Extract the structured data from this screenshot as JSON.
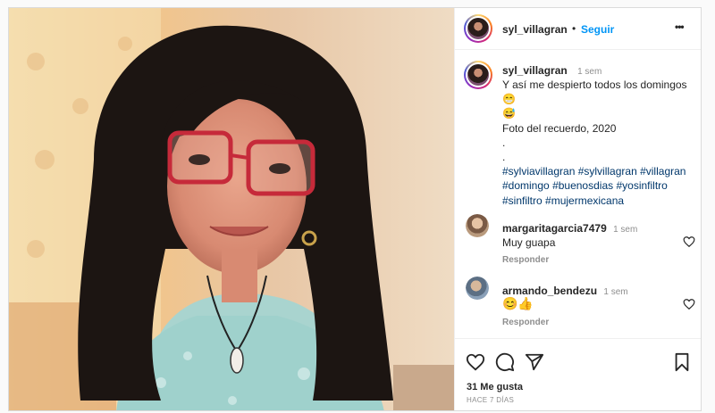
{
  "post": {
    "author": "syl_villagran",
    "separator": "•",
    "follow_label": "Seguir",
    "more_label": "•••",
    "caption": {
      "author": "syl_villagran",
      "age": "1 sem",
      "line1": "Y así me despierto todos los domingos😁",
      "line2": "😅",
      "line3": "Foto del recuerdo, 2020",
      "dot1": ".",
      "dot2": ".",
      "hashtags": [
        "#sylviavillagran",
        "#sylvillagran",
        "#villagran",
        "#domingo",
        "#buenosdias",
        "#yosinfiltro",
        "#sinfiltro",
        "#mujermexicana"
      ]
    },
    "comments": [
      {
        "user": "margaritagarcia7479",
        "age": "1 sem",
        "text": "Muy guapa",
        "reply_label": "Responder",
        "avatar_color": "#b99a7d"
      },
      {
        "user": "armando_bendezu",
        "age": "1 sem",
        "text": "😊👍",
        "reply_label": "Responder",
        "avatar_color": "#8aa0b8"
      }
    ],
    "likes": "31 Me gusta",
    "timestamp": "HACE 7 DÍAS",
    "icons": [
      "heart-icon",
      "comment-icon",
      "share-icon",
      "save-icon",
      "more-icon",
      "like-comment-icon"
    ]
  }
}
